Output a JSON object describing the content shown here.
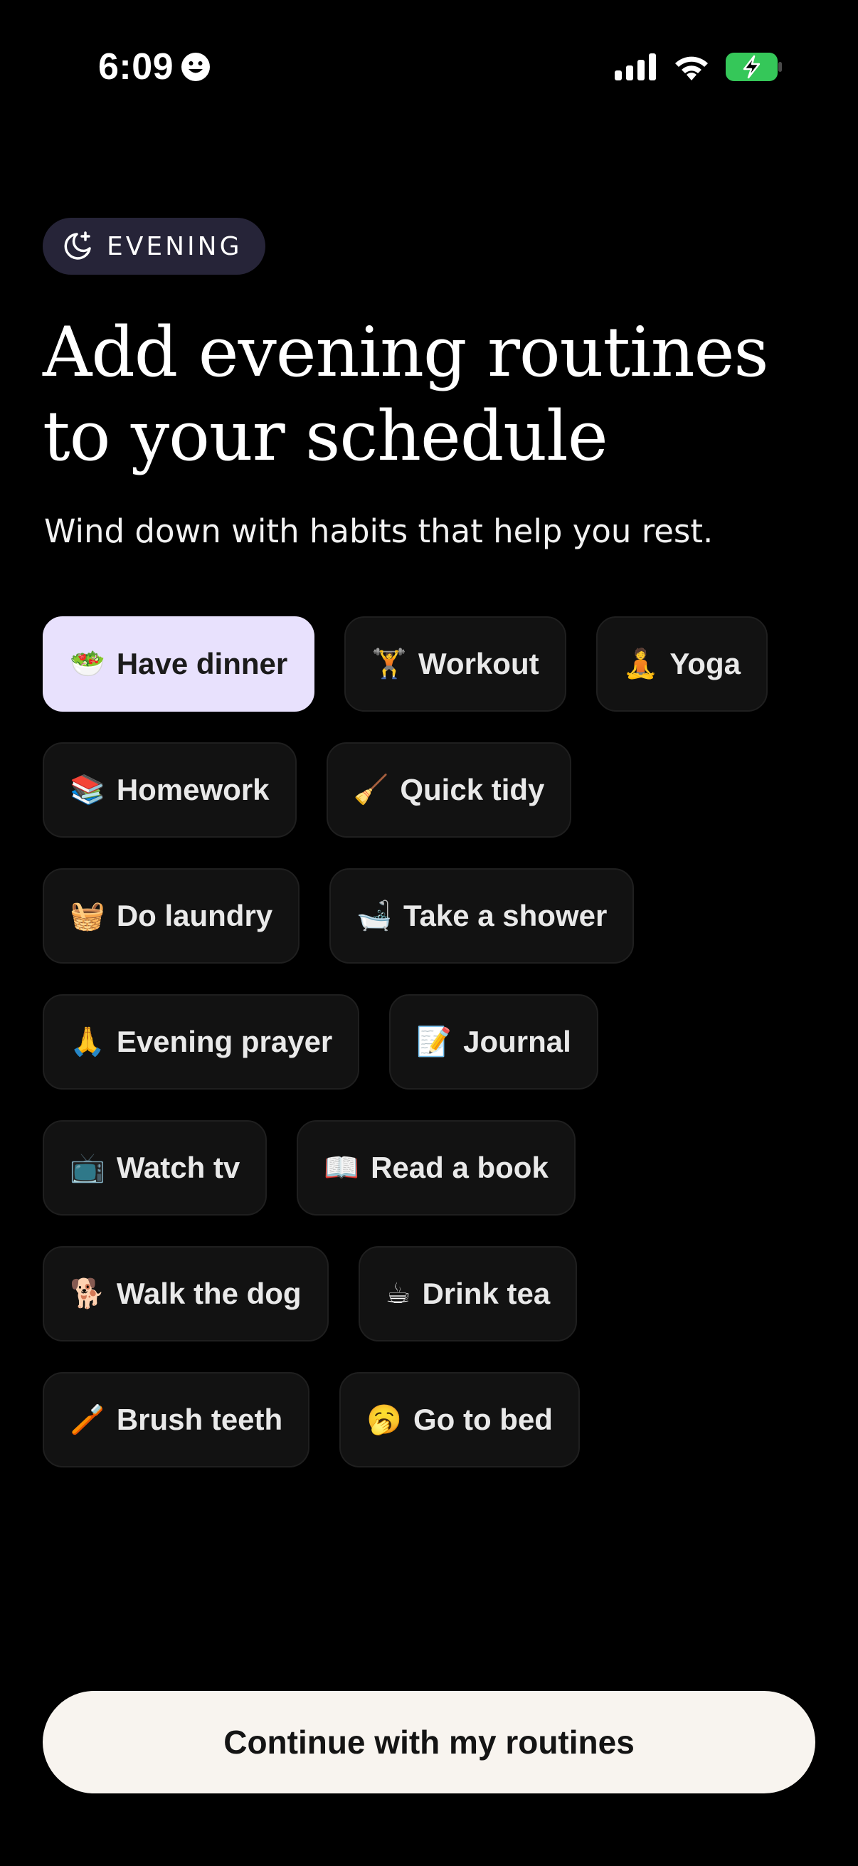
{
  "status_bar": {
    "time": "6:09",
    "icons": [
      "face-icon",
      "cellular-signal-icon",
      "wifi-icon",
      "battery-charging-icon"
    ],
    "battery_color": "#35c759"
  },
  "header": {
    "badge_icon": "moon-sparkle-icon",
    "badge_label": "EVENING",
    "title_line1": "Add evening routines",
    "title_line2": "to your schedule",
    "subtitle": "Wind down with habits that help you rest."
  },
  "colors": {
    "background": "#000000",
    "chip_background": "#121212",
    "chip_selected": "#e8e1fd",
    "badge_background": "#262438",
    "button_background": "#f8f4ef"
  },
  "routines": [
    {
      "emoji": "🥗",
      "label": "Have dinner",
      "selected": true
    },
    {
      "emoji": "🏋",
      "label": "Workout",
      "selected": false
    },
    {
      "emoji": "🧘",
      "label": "Yoga",
      "selected": false
    },
    {
      "emoji": "📚",
      "label": "Homework",
      "selected": false
    },
    {
      "emoji": "🧹",
      "label": "Quick tidy",
      "selected": false
    },
    {
      "emoji": "🧺",
      "label": "Do laundry",
      "selected": false
    },
    {
      "emoji": "🛁",
      "label": "Take a shower",
      "selected": false
    },
    {
      "emoji": "🙏",
      "label": "Evening prayer",
      "selected": false
    },
    {
      "emoji": "📝",
      "label": "Journal",
      "selected": false
    },
    {
      "emoji": "📺",
      "label": "Watch tv",
      "selected": false
    },
    {
      "emoji": "📖",
      "label": "Read a book",
      "selected": false
    },
    {
      "emoji": "🐕",
      "label": "Walk the dog",
      "selected": false
    },
    {
      "emoji": "☕",
      "label": "Drink tea",
      "selected": false
    },
    {
      "emoji": "🪥",
      "label": "Brush teeth",
      "selected": false
    },
    {
      "emoji": "🥱",
      "label": "Go to bed",
      "selected": false
    }
  ],
  "footer": {
    "continue_label": "Continue with my routines"
  }
}
